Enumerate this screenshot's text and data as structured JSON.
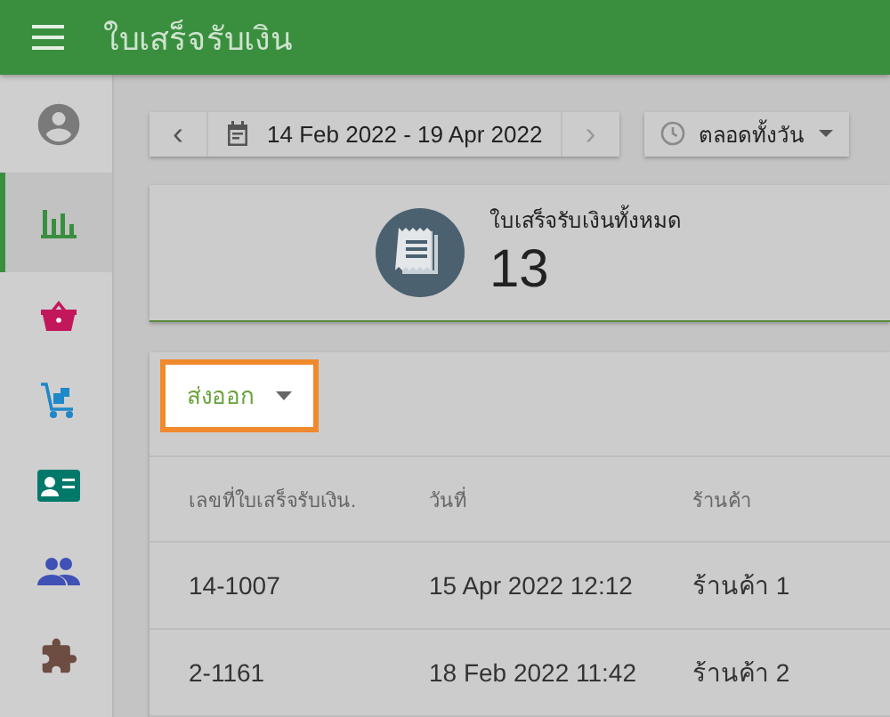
{
  "app_bar": {
    "title": "ใบเสร็จรับเงิน"
  },
  "sidebar": {
    "items": [
      {
        "selected": false
      },
      {
        "selected": true
      },
      {
        "selected": false
      },
      {
        "selected": false
      },
      {
        "selected": false
      },
      {
        "selected": false
      },
      {
        "selected": false
      }
    ]
  },
  "date_range": {
    "prev": "‹",
    "value": "14 Feb 2022 - 19 Apr 2022",
    "next": "›",
    "next_disabled": true
  },
  "time_filter": {
    "value": "ตลอดทั้งวัน"
  },
  "summary": {
    "label": "ใบเสร็จรับเงินทั้งหมด",
    "count": "13"
  },
  "export_button": {
    "label": "ส่งออก",
    "highlighted": true
  },
  "table": {
    "columns": [
      "เลขที่ใบเสร็จรับเงิน.",
      "วันที่",
      "ร้านค้า"
    ],
    "rows": [
      [
        "14-1007",
        "15 Apr 2022 12:12",
        "ร้านค้า 1"
      ],
      [
        "2-1161",
        "18 Feb 2022 11:42",
        "ร้านค้า 2"
      ]
    ]
  }
}
